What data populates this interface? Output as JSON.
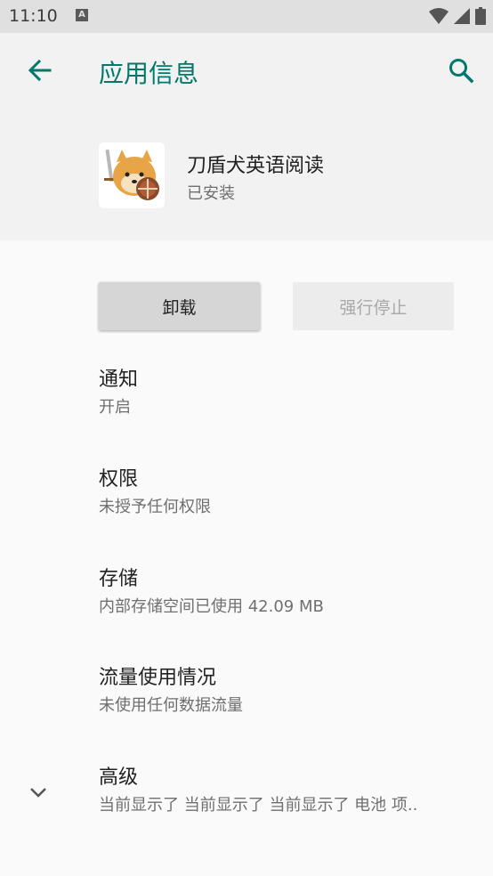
{
  "status_bar": {
    "time": "11:10",
    "notification_letter": "A"
  },
  "app_bar": {
    "title": "应用信息",
    "back_icon": "arrow-back-icon",
    "search_icon": "search-icon",
    "accent_color": "#00796b"
  },
  "app": {
    "name": "刀盾犬英语阅读",
    "status": "已安装"
  },
  "buttons": {
    "uninstall": "卸载",
    "force_stop": "强行停止"
  },
  "settings": [
    {
      "title": "通知",
      "subtitle": "开启"
    },
    {
      "title": "权限",
      "subtitle": "未授予任何权限"
    },
    {
      "title": "存储",
      "subtitle": "内部存储空间已使用 42.09 MB"
    },
    {
      "title": "流量使用情况",
      "subtitle": "未使用任何数据流量"
    },
    {
      "title": "高级",
      "subtitle": "当前显示了 当前显示了 当前显示了 电池 项.."
    }
  ]
}
